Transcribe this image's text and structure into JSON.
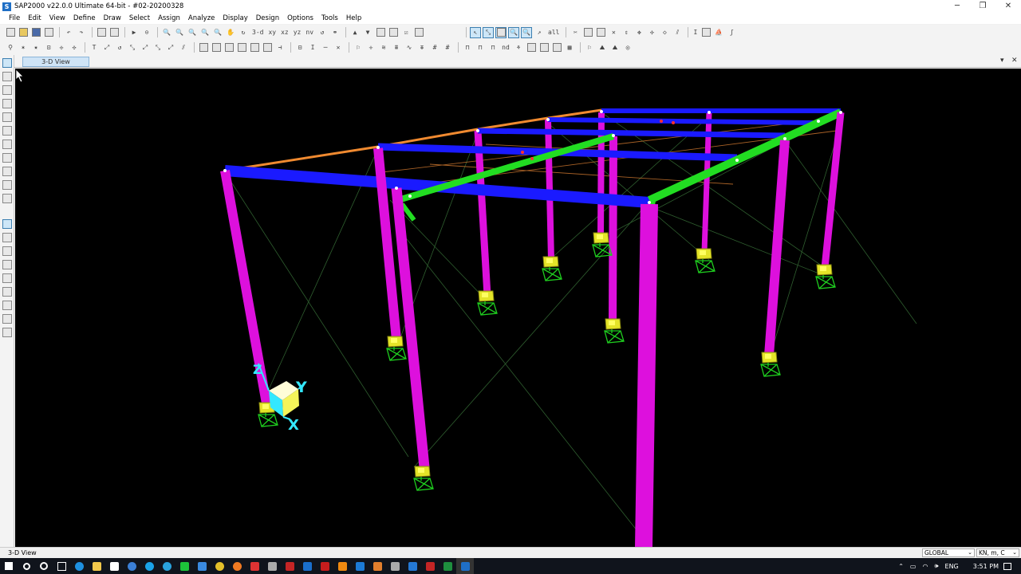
{
  "window": {
    "title": "SAP2000 v22.0.0 Ultimate 64-bit - #02-20200328",
    "app_icon_letter": "S",
    "minimize": "─",
    "restore": "❐",
    "close": "✕"
  },
  "menu": [
    "File",
    "Edit",
    "View",
    "Define",
    "Draw",
    "Select",
    "Assign",
    "Analyze",
    "Display",
    "Design",
    "Options",
    "Tools",
    "Help"
  ],
  "toolbar_labels": {
    "view_3d": "3-d",
    "view_xy": "xy",
    "view_xz": "xz",
    "view_yz": "yz",
    "view_nv": "nv",
    "all": "all",
    "text_tool": "I"
  },
  "tab": {
    "label": "3-D View",
    "dropdown": "▾",
    "close": "✕"
  },
  "axes": {
    "x": "X",
    "y": "Y",
    "z": "Z"
  },
  "status": {
    "view_name": "3-D View",
    "coord_system": "GLOBAL",
    "units": "KN, m, C"
  },
  "taskbar": {
    "language": "ENG",
    "time": "3:51 PM"
  },
  "colors": {
    "columns": "#dd10dd",
    "beams_x": "#1a1aff",
    "rafters": "#22dd22",
    "roof_edge": "#f08a30",
    "supports": "#e4e428",
    "restraints": "#1fce1f",
    "bracing": "#3a6a3a"
  }
}
